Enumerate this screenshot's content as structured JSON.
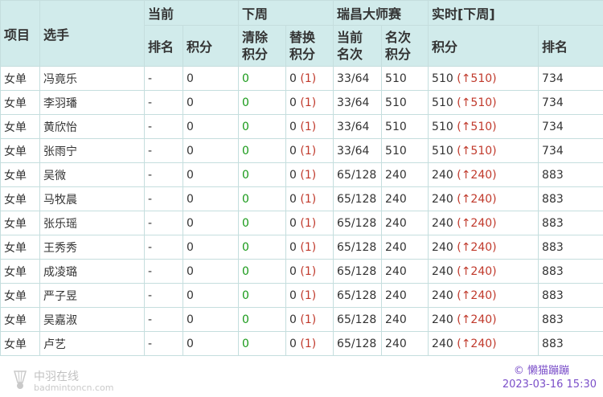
{
  "headers": {
    "event": "项目",
    "player": "选手",
    "current": "当前",
    "next_week": "下周",
    "tournament": "瑞昌大师赛",
    "live": "实时[下周]",
    "rank": "排名",
    "points": "积分",
    "clear_points_l1": "清除",
    "clear_points_l2": "积分",
    "replace_points_l1": "替换",
    "replace_points_l2": "积分",
    "current_round_l1": "当前",
    "current_round_l2": "名次",
    "round_points_l1": "名次",
    "round_points_l2": "积分",
    "live_points": "积分",
    "live_rank": "排名"
  },
  "rows": [
    {
      "event": "女单",
      "player": "冯竟乐",
      "cur_rank": "-",
      "cur_points": "0",
      "clear": "0",
      "replace": "0",
      "replace_note": "(1)",
      "round": "33/64",
      "round_points": "510",
      "live_points": "510",
      "live_delta": "(↑510)",
      "live_rank": "734"
    },
    {
      "event": "女单",
      "player": "李羽璠",
      "cur_rank": "-",
      "cur_points": "0",
      "clear": "0",
      "replace": "0",
      "replace_note": "(1)",
      "round": "33/64",
      "round_points": "510",
      "live_points": "510",
      "live_delta": "(↑510)",
      "live_rank": "734"
    },
    {
      "event": "女单",
      "player": "黄欣怡",
      "cur_rank": "-",
      "cur_points": "0",
      "clear": "0",
      "replace": "0",
      "replace_note": "(1)",
      "round": "33/64",
      "round_points": "510",
      "live_points": "510",
      "live_delta": "(↑510)",
      "live_rank": "734"
    },
    {
      "event": "女单",
      "player": "张雨宁",
      "cur_rank": "-",
      "cur_points": "0",
      "clear": "0",
      "replace": "0",
      "replace_note": "(1)",
      "round": "33/64",
      "round_points": "510",
      "live_points": "510",
      "live_delta": "(↑510)",
      "live_rank": "734"
    },
    {
      "event": "女单",
      "player": "吴微",
      "cur_rank": "-",
      "cur_points": "0",
      "clear": "0",
      "replace": "0",
      "replace_note": "(1)",
      "round": "65/128",
      "round_points": "240",
      "live_points": "240",
      "live_delta": "(↑240)",
      "live_rank": "883"
    },
    {
      "event": "女单",
      "player": "马牧晨",
      "cur_rank": "-",
      "cur_points": "0",
      "clear": "0",
      "replace": "0",
      "replace_note": "(1)",
      "round": "65/128",
      "round_points": "240",
      "live_points": "240",
      "live_delta": "(↑240)",
      "live_rank": "883"
    },
    {
      "event": "女单",
      "player": "张乐瑶",
      "cur_rank": "-",
      "cur_points": "0",
      "clear": "0",
      "replace": "0",
      "replace_note": "(1)",
      "round": "65/128",
      "round_points": "240",
      "live_points": "240",
      "live_delta": "(↑240)",
      "live_rank": "883"
    },
    {
      "event": "女单",
      "player": "王秀秀",
      "cur_rank": "-",
      "cur_points": "0",
      "clear": "0",
      "replace": "0",
      "replace_note": "(1)",
      "round": "65/128",
      "round_points": "240",
      "live_points": "240",
      "live_delta": "(↑240)",
      "live_rank": "883"
    },
    {
      "event": "女单",
      "player": "成凌璐",
      "cur_rank": "-",
      "cur_points": "0",
      "clear": "0",
      "replace": "0",
      "replace_note": "(1)",
      "round": "65/128",
      "round_points": "240",
      "live_points": "240",
      "live_delta": "(↑240)",
      "live_rank": "883"
    },
    {
      "event": "女单",
      "player": "严子昱",
      "cur_rank": "-",
      "cur_points": "0",
      "clear": "0",
      "replace": "0",
      "replace_note": "(1)",
      "round": "65/128",
      "round_points": "240",
      "live_points": "240",
      "live_delta": "(↑240)",
      "live_rank": "883"
    },
    {
      "event": "女单",
      "player": "吴嘉淑",
      "cur_rank": "-",
      "cur_points": "0",
      "clear": "0",
      "replace": "0",
      "replace_note": "(1)",
      "round": "65/128",
      "round_points": "240",
      "live_points": "240",
      "live_delta": "(↑240)",
      "live_rank": "883"
    },
    {
      "event": "女单",
      "player": "卢艺",
      "cur_rank": "-",
      "cur_points": "0",
      "clear": "0",
      "replace": "0",
      "replace_note": "(1)",
      "round": "65/128",
      "round_points": "240",
      "live_points": "240",
      "live_delta": "(↑240)",
      "live_rank": "883"
    }
  ],
  "footer": {
    "logo_name": "中羽在线",
    "logo_url": "badmintoncn.com",
    "credit": "© 懒猫蹦蹦",
    "timestamp": "2023-03-16 15:30"
  },
  "colors": {
    "header_bg": "#d1ebeb",
    "border": "#c5dede",
    "clear_points": "#1a9a1a",
    "delta": "#c0392b",
    "credit": "#7b4fc9"
  }
}
